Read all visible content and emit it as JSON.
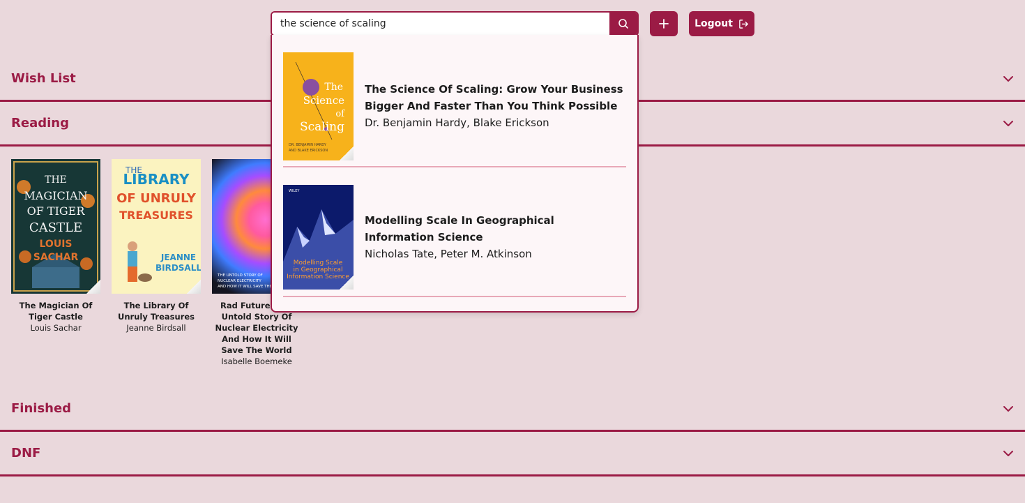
{
  "search": {
    "value": "the science of scaling"
  },
  "actions": {
    "logout_label": "Logout"
  },
  "sections": [
    {
      "title": "Wish List"
    },
    {
      "title": "Reading"
    },
    {
      "title": "Finished"
    },
    {
      "title": "DNF"
    }
  ],
  "reading_books": [
    {
      "title": "The Magician Of Tiger Castle",
      "author": "Louis Sachar",
      "cover": {
        "l1": "THE",
        "l2": "MAGICIAN",
        "l3": "OF TIGER",
        "l4": "CASTLE",
        "l5": "LOUIS",
        "l6": "SACHAR"
      }
    },
    {
      "title": "The Library Of Unruly Treasures",
      "author": "Jeanne Birdsall",
      "cover": {
        "l1": "THE",
        "l2": "LIBRARY",
        "l3": "OF UNRULY",
        "l4": "TREASURES",
        "l5": "JEANNE",
        "l6": "BIRDSALL"
      }
    },
    {
      "title": "Rad Future: The Untold Story Of Nuclear Electricity And How It Will Save The World",
      "author": "Isabelle Boemeke",
      "cover": {
        "l1": "THE UNTOLD STORY OF",
        "l2": "NUCLEAR ELECTRICITY",
        "l3": "AND HOW IT WILL SAVE THE WORLD"
      }
    }
  ],
  "search_results": [
    {
      "title": "The Science Of Scaling: Grow Your Business Bigger And Faster Than You Think Possible",
      "author": "Dr. Benjamin Hardy, Blake Erickson",
      "cover": {
        "l1": "The",
        "l2": "Science",
        "l3": "of",
        "l4": "Scaling",
        "l5": "DR. BENJAMIN HARDY",
        "l6": "AND BLAKE ERICKSON"
      }
    },
    {
      "title": "Modelling Scale In Geographical Information Science",
      "author": "Nicholas Tate, Peter M. Atkinson",
      "cover": {
        "l1": "WILEY",
        "l2": "Modelling Scale",
        "l3": "in Geographical",
        "l4": "Information Science"
      }
    }
  ],
  "colors": {
    "accent": "#9b1b45",
    "background": "#ead8dc",
    "divider": "#e8a8b7"
  }
}
